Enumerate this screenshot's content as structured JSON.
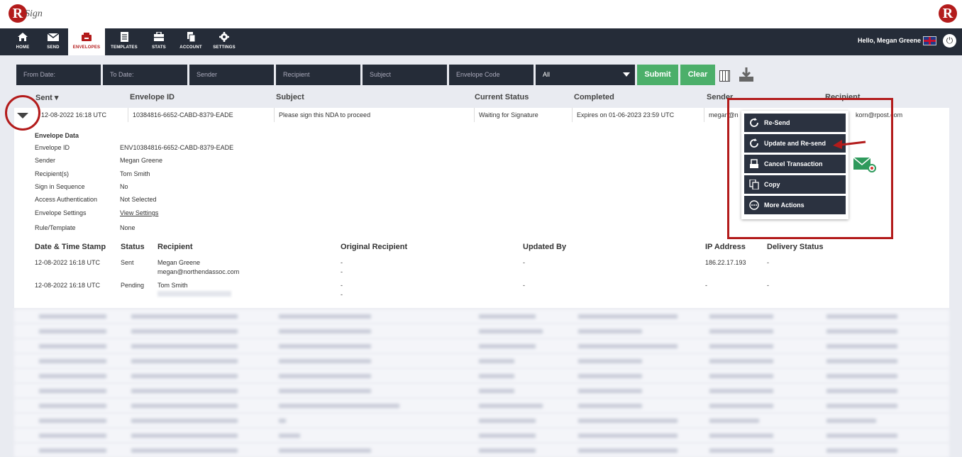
{
  "app": {
    "logo_text": "R",
    "logo_sub": "Sign"
  },
  "nav": {
    "items": [
      {
        "label": "HOME",
        "icon": "home-icon"
      },
      {
        "label": "SEND",
        "icon": "mail-icon"
      },
      {
        "label": "ENVELOPES",
        "icon": "inbox-icon",
        "active": true
      },
      {
        "label": "TEMPLATES",
        "icon": "document-icon"
      },
      {
        "label": "STATS",
        "icon": "briefcase-icon"
      },
      {
        "label": "ACCOUNT",
        "icon": "copy-icon"
      },
      {
        "label": "SETTINGS",
        "icon": "gear-icon"
      }
    ],
    "greeting": "Hello, Megan Greene"
  },
  "filters": {
    "from_date": "From Date:",
    "to_date": "To Date:",
    "sender": "Sender",
    "recipient": "Recipient",
    "subject": "Subject",
    "envelope_code": "Envelope Code",
    "status_select": "All",
    "submit": "Submit",
    "clear": "Clear"
  },
  "table": {
    "headers": {
      "sent": "Sent",
      "envelope_id": "Envelope ID",
      "subject": "Subject",
      "current_status": "Current Status",
      "completed": "Completed",
      "sender": "Sender",
      "recipient": "Recipient"
    },
    "row": {
      "sent": "12-08-2022 16:18 UTC",
      "envelope_id": "10384816-6652-CABD-8379-EADE",
      "subject": "Please sign this NDA to proceed",
      "status": "Waiting for Signature",
      "completed": "Expires on 01-06-2023 23:59 UTC",
      "sender": "megan@n",
      "recipient": "korn@rpost.com"
    }
  },
  "envelope_data": {
    "title": "Envelope Data",
    "fields": [
      {
        "label": "Envelope ID",
        "value": "ENV10384816-6652-CABD-8379-EADE"
      },
      {
        "label": "Sender",
        "value": "Megan Greene"
      },
      {
        "label": "Recipient(s)",
        "value": "Tom Smith"
      },
      {
        "label": "Sign in Sequence",
        "value": "No"
      },
      {
        "label": "Access Authentication",
        "value": "Not Selected"
      },
      {
        "label": "Envelope Settings",
        "value": "View Settings"
      },
      {
        "label": "Rule/Template",
        "value": "None"
      }
    ]
  },
  "history": {
    "headers": {
      "date": "Date & Time Stamp",
      "status": "Status",
      "recipient": "Recipient",
      "original": "Original Recipient",
      "updated_by": "Updated By",
      "ip": "IP Address",
      "delivery": "Delivery Status"
    },
    "rows": [
      {
        "date": "12-08-2022 16:18 UTC",
        "status": "Sent",
        "recipient": "Megan Greene",
        "recipient_email": "megan@northendassoc.com",
        "original": "-",
        "original2": "-",
        "updated_by": "-",
        "ip": "186.22.17.193",
        "delivery": "-"
      },
      {
        "date": "12-08-2022 16:18 UTC",
        "status": "Pending",
        "recipient": "Tom Smith",
        "recipient_email": "",
        "original": "-",
        "original2": "-",
        "updated_by": "-",
        "ip": "-",
        "delivery": "-"
      }
    ]
  },
  "actions_menu": {
    "items": [
      {
        "label": "Re-Send",
        "icon": "refresh-icon"
      },
      {
        "label": "Update and Re-send",
        "icon": "refresh-icon"
      },
      {
        "label": "Cancel Transaction",
        "icon": "inbox-cancel-icon"
      },
      {
        "label": "Copy",
        "icon": "copy-icon"
      },
      {
        "label": "More Actions",
        "icon": "more-icon"
      }
    ]
  },
  "colors": {
    "brand_red": "#b31b1b",
    "nav_bg": "#252c38",
    "green": "#4caf6a"
  }
}
